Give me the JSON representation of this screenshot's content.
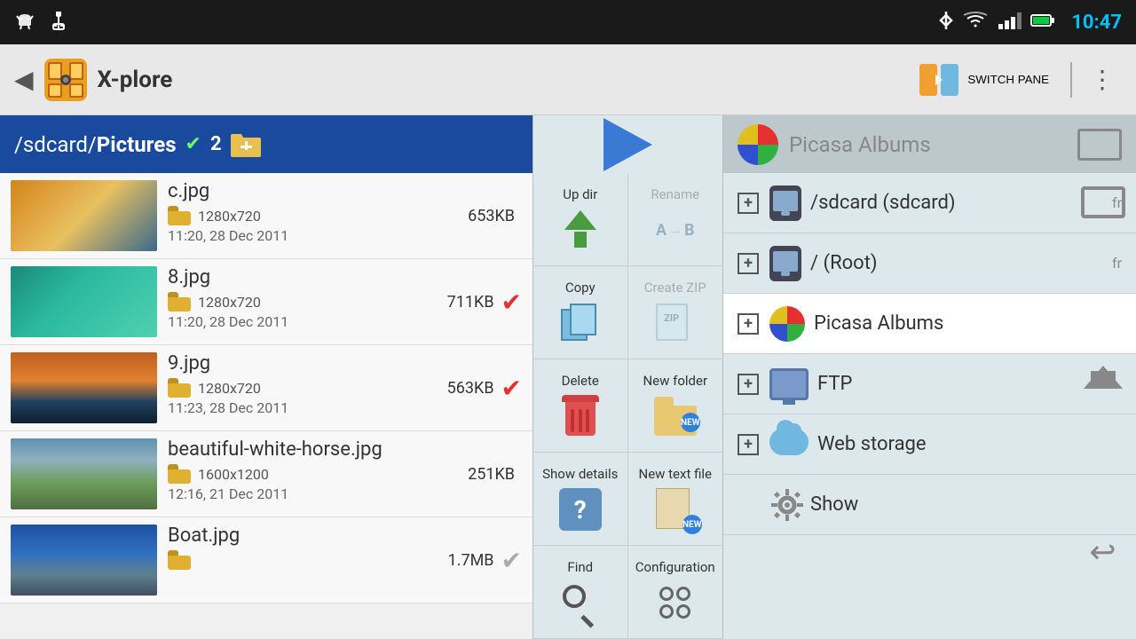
{
  "statusBar": {
    "time": "10:47",
    "leftIcons": [
      "android-icon",
      "usb-icon"
    ],
    "rightIcons": [
      "bluetooth-icon",
      "wifi-icon",
      "signal-icon",
      "battery-icon"
    ]
  },
  "appBar": {
    "backLabel": "◀",
    "title": "X-plore",
    "switchPaneLabel": "SWITCH PANE",
    "moreLabel": "⋮"
  },
  "leftPane": {
    "pathLabel": "/sdcard/",
    "pathBold": "Pictures",
    "pathCheck": "✔",
    "pathCount": "2",
    "files": [
      {
        "name": "c",
        "ext": ".jpg",
        "dims": "1280x720",
        "size": "653KB",
        "date": "11:20, 28 Dec 2011",
        "checked": false,
        "thumbClass": "thumb-orange"
      },
      {
        "name": "8",
        "ext": ".jpg",
        "dims": "1280x720",
        "size": "711KB",
        "date": "11:20, 28 Dec 2011",
        "checked": true,
        "thumbClass": "thumb-teal"
      },
      {
        "name": "9",
        "ext": ".jpg",
        "dims": "1280x720",
        "size": "563KB",
        "date": "11:23, 28 Dec 2011",
        "checked": true,
        "thumbClass": "thumb-sunset"
      },
      {
        "name": "beautiful-white-horse",
        "ext": ".jpg",
        "dims": "1600x1200",
        "size": "251KB",
        "date": "12:16, 21 Dec 2011",
        "checked": false,
        "thumbClass": "thumb-horse"
      },
      {
        "name": "Boat",
        "ext": ".jpg",
        "dims": "",
        "size": "1.7MB",
        "date": "",
        "checked": false,
        "thumbClass": "thumb-boat"
      }
    ]
  },
  "middlePane": {
    "actions": [
      {
        "label": "Up dir",
        "iconType": "up-dir",
        "disabled": false
      },
      {
        "label": "Rename",
        "iconType": "rename",
        "disabled": true
      },
      {
        "label": "Copy",
        "iconType": "copy",
        "disabled": false
      },
      {
        "label": "Create ZIP",
        "iconType": "zip",
        "disabled": true
      },
      {
        "label": "Delete",
        "iconType": "trash",
        "disabled": false
      },
      {
        "label": "New folder",
        "iconType": "new-folder",
        "disabled": false
      },
      {
        "label": "Show details",
        "iconType": "question",
        "disabled": false
      },
      {
        "label": "New text file",
        "iconType": "new-text",
        "disabled": false
      },
      {
        "label": "Find",
        "iconType": "find",
        "disabled": false
      },
      {
        "label": "Configuration",
        "iconType": "config",
        "disabled": false
      }
    ]
  },
  "rightPane": {
    "title": "Picasa Albums",
    "locations": [
      {
        "name": "/sdcard (sdcard)",
        "tag": "fr",
        "iconType": "phone",
        "expandable": true
      },
      {
        "name": "/ (Root)",
        "tag": "fr",
        "iconType": "phone",
        "expandable": true
      },
      {
        "name": "Picasa Albums",
        "tag": "",
        "iconType": "picasa",
        "expandable": true,
        "highlighted": true
      },
      {
        "name": "FTP",
        "tag": "",
        "iconType": "monitor",
        "expandable": true
      },
      {
        "name": "Web storage",
        "tag": "",
        "iconType": "cloud",
        "expandable": true
      },
      {
        "name": "Show",
        "tag": "",
        "iconType": "gear",
        "expandable": false
      }
    ]
  },
  "navBar": {
    "icons": [
      "window-icon",
      "home-icon",
      "back-icon"
    ]
  }
}
